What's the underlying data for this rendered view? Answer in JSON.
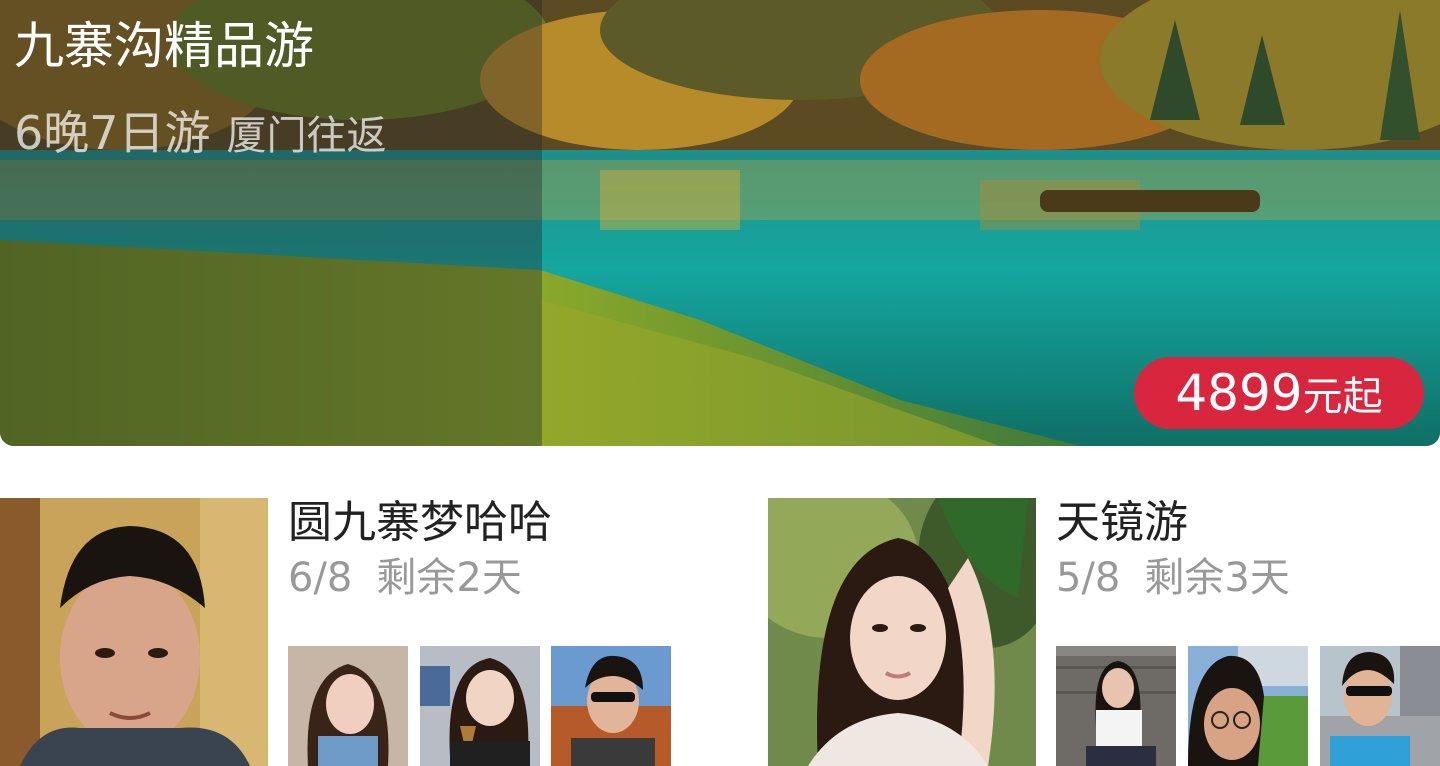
{
  "hero": {
    "title": "九寨沟精品游",
    "duration": "6晚7日游",
    "route": "厦门往返",
    "price": "4899",
    "price_unit": "元起",
    "badge_color": "#d8263f"
  },
  "groups": [
    {
      "name": "圆九寨梦哈哈",
      "members_count": "6/8",
      "remaining": "剩余2天",
      "leader_photo": "male-portrait-photo",
      "member_photos": [
        "female-portrait-photo",
        "female-icecream-photo",
        "male-sunglasses-photo"
      ]
    },
    {
      "name": "天镜游",
      "members_count": "5/8",
      "remaining": "剩余3天",
      "leader_photo": "female-portrait-photo",
      "member_photos": [
        "female-sitting-photo",
        "male-glasses-photo",
        "male-sunglasses-photo"
      ]
    }
  ]
}
